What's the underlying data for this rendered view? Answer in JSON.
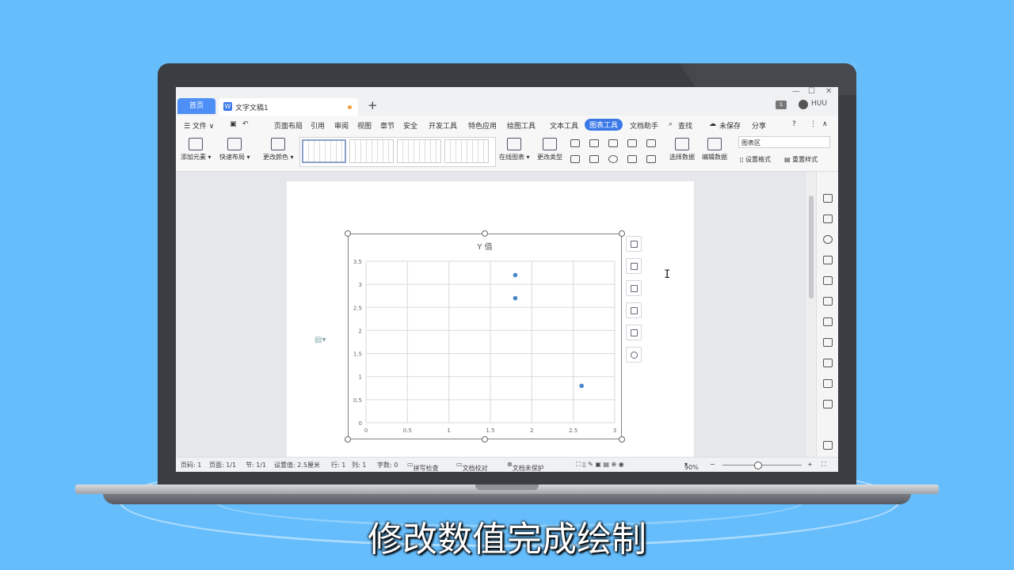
{
  "subtitle": "修改数值完成绘制",
  "titlebar": {
    "home_tab": "首页",
    "doc_tab": "文字文稿1",
    "new_tab": "+",
    "badge": "1",
    "user": "HUU",
    "controls": [
      "—",
      "☐",
      "✕"
    ]
  },
  "menu": {
    "file": "☰ 文件 ∨",
    "items": [
      "页面布局",
      "引用",
      "审阅",
      "视图",
      "章节",
      "安全",
      "开发工具",
      "特色应用",
      "绘图工具",
      "文本工具"
    ],
    "active": "图表工具",
    "assistant": "文档助手",
    "search": "查找",
    "unsaved": "未保存",
    "share": "分享"
  },
  "ribbon": {
    "add_element": "添加元素",
    "quick_layout": "快速布局",
    "change_color": "更改颜色",
    "online_chart": "在线图表",
    "change_type": "更改类型",
    "select_data": "选择数据",
    "edit_data": "编辑数据",
    "chart_area": "图表区",
    "set_format": "设置格式",
    "reset_style": "重置样式"
  },
  "status": {
    "page_no": "页码: 1",
    "pages": "页面: 1/1",
    "section": "节: 1/1",
    "setting": "设置值: 2.5厘米",
    "row": "行: 1",
    "col": "列: 1",
    "words": "字数: 0",
    "spell": "拼写检查",
    "proof": "文档校对",
    "protect": "文档未保护",
    "zoom": "90%"
  },
  "chart_data": {
    "type": "scatter",
    "title": "Y 值",
    "x": [
      1.8,
      1.8,
      2.6
    ],
    "y": [
      3.2,
      2.7,
      0.8
    ],
    "xlim": [
      0,
      3
    ],
    "ylim": [
      0,
      3.5
    ],
    "x_ticks": [
      "0",
      "0.5",
      "1",
      "1.5",
      "2",
      "2.5",
      "3"
    ],
    "y_ticks": [
      "0",
      "0.5",
      "1",
      "1.5",
      "2",
      "2.5",
      "3",
      "3.5"
    ],
    "grid": true,
    "color": "#4a86c8"
  }
}
